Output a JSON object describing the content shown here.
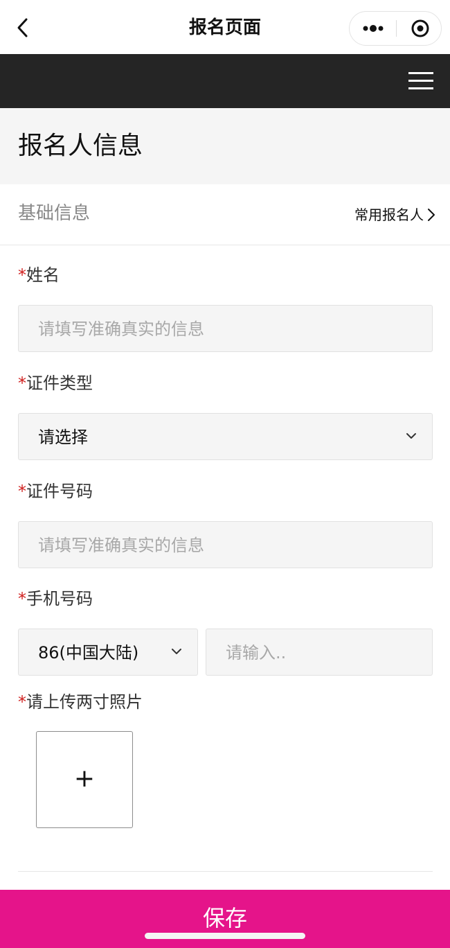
{
  "navbar": {
    "title": "报名页面",
    "back_icon": "chevron-left-icon",
    "more_icon": "more-dots-icon",
    "close_icon": "target-circle-icon"
  },
  "topbar": {
    "menu_icon": "hamburger-menu-icon",
    "background": "#252525"
  },
  "section": {
    "title": "报名人信息"
  },
  "basic": {
    "label": "基础信息",
    "common_link": "常用报名人"
  },
  "form": {
    "required_mark": "*",
    "name": {
      "label": "姓名",
      "placeholder": "请填写准确真实的信息"
    },
    "id_type": {
      "label": "证件类型",
      "value": "请选择"
    },
    "id_number": {
      "label": "证件号码",
      "placeholder": "请填写准确真实的信息"
    },
    "phone": {
      "label": "手机号码",
      "country_code": "86(中国大陆)",
      "placeholder": "请输入.."
    },
    "photo": {
      "label": "请上传两寸照片",
      "add_symbol": "+"
    }
  },
  "actions": {
    "save_label": "保存",
    "accent": "#e5148a"
  }
}
